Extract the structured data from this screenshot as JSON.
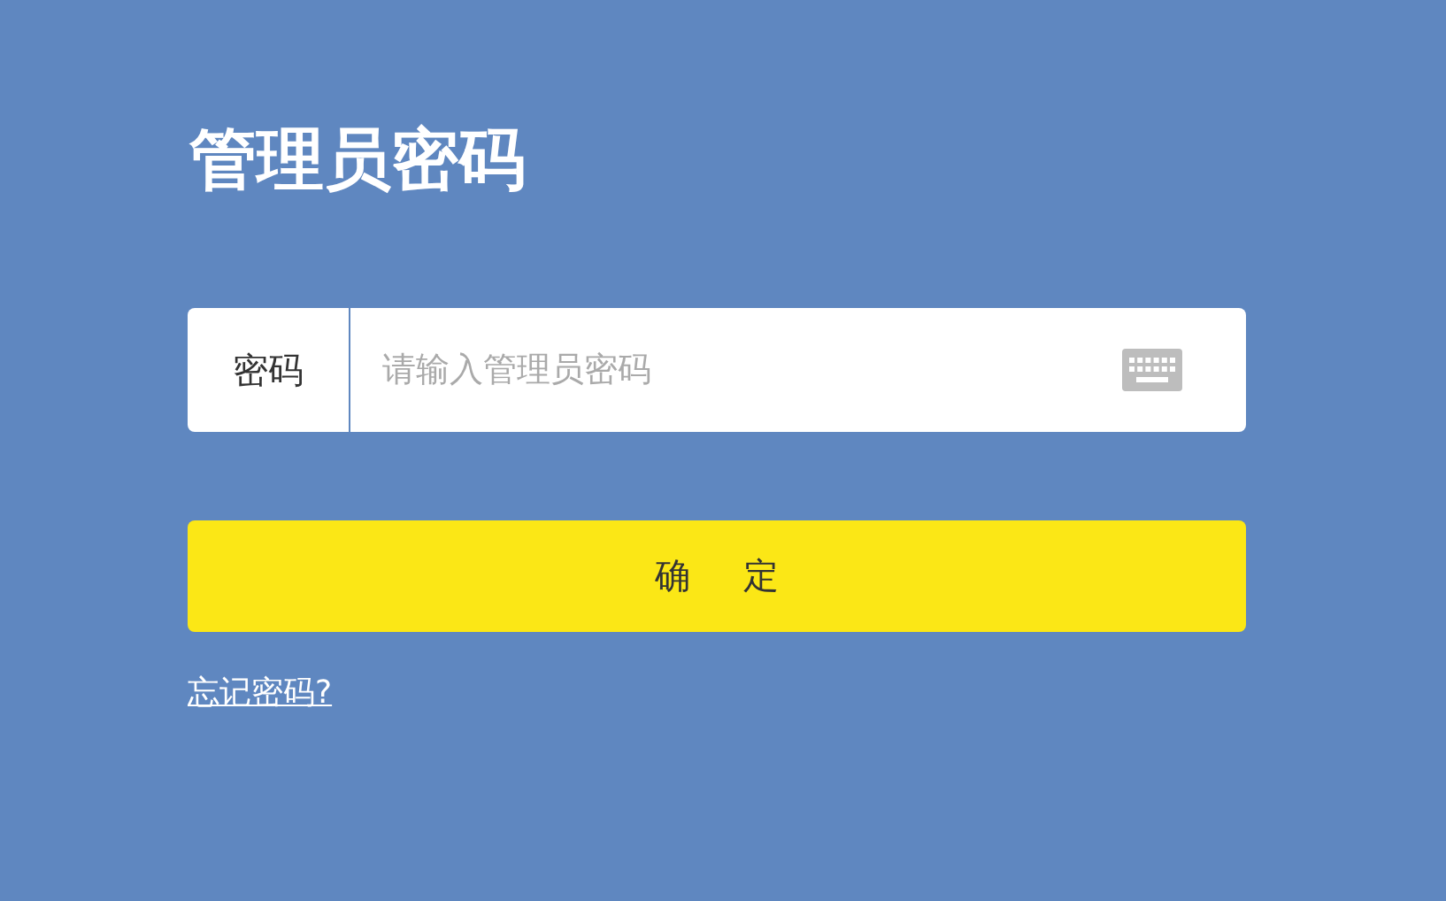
{
  "title": "管理员密码",
  "password_field": {
    "label": "密码",
    "placeholder": "请输入管理员密码"
  },
  "confirm_button": {
    "label": "确 定"
  },
  "forgot_link": {
    "label": "忘记密码?"
  }
}
